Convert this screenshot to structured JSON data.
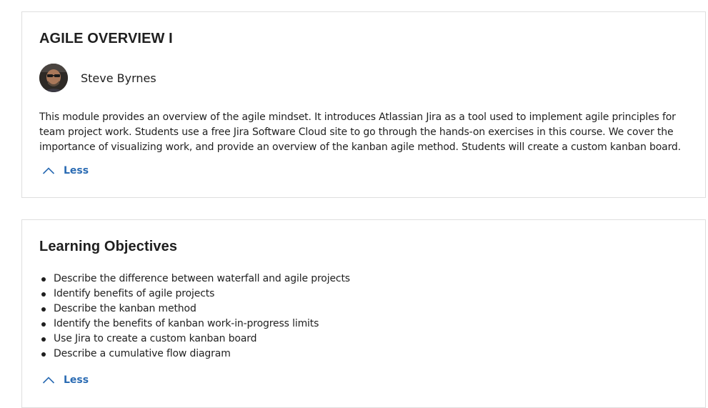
{
  "overview": {
    "title": "AGILE OVERVIEW I",
    "author": "Steve Byrnes",
    "description": "This module provides an overview of the agile mindset. It introduces Atlassian Jira as a tool used to implement agile principles for team project work. Students use a free Jira Software Cloud site to go through the hands-on exercises in this course. We cover the importance of visualizing work, and provide an overview of the kanban agile method. Students will create a custom kanban board.",
    "toggle_label": "Less",
    "toggle_icon": "chevron-up-icon"
  },
  "objectives": {
    "title": "Learning Objectives",
    "items": [
      "Describe the difference between waterfall and agile projects",
      "Identify benefits of agile projects",
      "Describe the kanban method",
      "Identify the benefits of kanban work-in-progress limits",
      "Use Jira to create a custom kanban board",
      "Describe a cumulative flow diagram"
    ],
    "toggle_label": "Less",
    "toggle_icon": "chevron-up-icon"
  },
  "colors": {
    "accent": "#2a6bb3",
    "border": "#dedede",
    "text": "#1f1f1f"
  }
}
